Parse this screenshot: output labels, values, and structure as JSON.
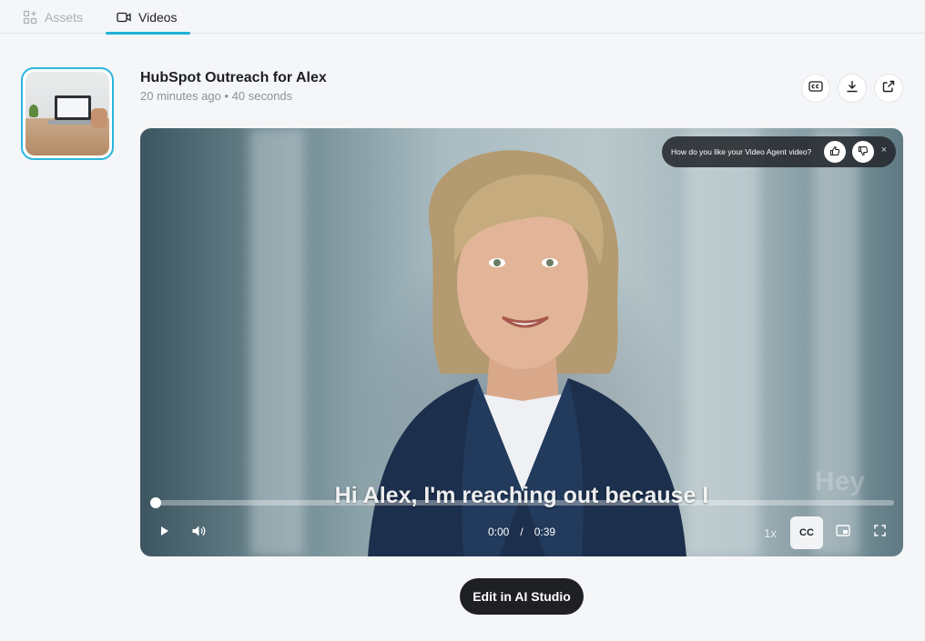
{
  "tabs": [
    {
      "label": "Assets",
      "icon": "assets-grid-icon",
      "active": false
    },
    {
      "label": "Videos",
      "icon": "video-camera-icon",
      "active": true
    }
  ],
  "video": {
    "title": "HubSpot Outreach for Alex",
    "meta": "20 minutes ago • 40 seconds",
    "caption": "Hi Alex, I'm reaching out because I",
    "watermark": "Hey",
    "current_time": "0:00",
    "separator": "/",
    "duration": "0:39",
    "speed": "1x",
    "cc_label": "CC",
    "progress_fraction": 0.0
  },
  "feedback": {
    "question": "How do you like your Video Agent video?",
    "close": "×"
  },
  "header_actions": [
    "captions-icon",
    "download-icon",
    "open-external-icon"
  ],
  "edit_button": {
    "label": "Edit in AI Studio"
  },
  "colors": {
    "accent": "#1fb0d6",
    "dark_button": "#1f2024",
    "background": "#f5f6f8"
  }
}
